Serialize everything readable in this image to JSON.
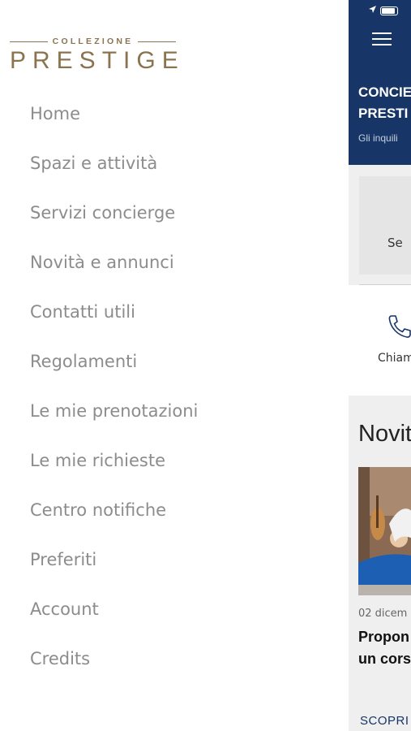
{
  "brand": {
    "small": "COLLEZIONE",
    "big": "PRESTIGE",
    "color": "#8a744f"
  },
  "menu": {
    "items": [
      {
        "label": "Home"
      },
      {
        "label": "Spazi e attività"
      },
      {
        "label": "Servizi concierge"
      },
      {
        "label": "Novità e annunci"
      },
      {
        "label": "Contatti utili"
      },
      {
        "label": "Regolamenti"
      },
      {
        "label": "Le mie prenotazioni"
      },
      {
        "label": "Le mie richieste"
      },
      {
        "label": "Centro notifiche"
      },
      {
        "label": "Preferiti"
      },
      {
        "label": "Account"
      },
      {
        "label": "Credits"
      }
    ]
  },
  "main": {
    "header_color": "#173566",
    "title_line1": "CONCIE",
    "title_line2": "PRESTI",
    "subtitle": "Gli inquili",
    "card_label": "Se",
    "quick_action_label": "Chiam",
    "section_title": "Novit",
    "news": {
      "date": "02 dicem",
      "title_line1": "Propon",
      "title_line2": "un cors",
      "cta": "SCOPRI"
    }
  },
  "icons": {
    "menu": "hamburger-icon",
    "phone": "phone-icon",
    "location": "location-arrow-icon",
    "battery": "battery-icon"
  }
}
